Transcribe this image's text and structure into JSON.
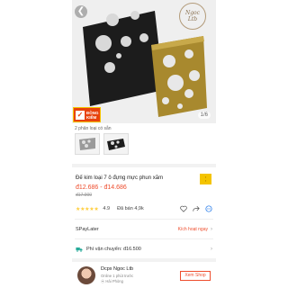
{
  "hero": {
    "watermark_line1": "Ngoc",
    "watermark_line2": "Ltb",
    "counter": "1/6",
    "badge_line1": "ĐỒNG",
    "badge_line2": "KIỂM"
  },
  "variants": {
    "label": "2 phân loại có sẵn"
  },
  "product": {
    "title": "Đế kim loại 7 ô đựng mực phun xăm",
    "price": "đ12.686 - đ14.686",
    "old_price": "đ17.900",
    "rating": "4.9",
    "sold": "Đã bán 4,9k"
  },
  "spaylater": {
    "label": "SPayLater",
    "action": "Kích hoạt ngay"
  },
  "shipping": {
    "label": "Phí vận chuyển: đ16.500"
  },
  "shop": {
    "name": "Dcpx Ngoc Ltb",
    "online": "Online 1 phút trước",
    "location": "Hải Phòng",
    "view_button": "Xem Shop"
  },
  "colors": {
    "accent": "#ee4d2d",
    "star": "#ffce3d",
    "badge": "#e8420d"
  }
}
